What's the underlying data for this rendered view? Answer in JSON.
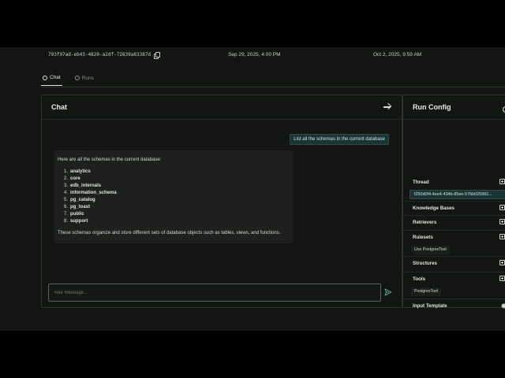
{
  "meta": {
    "run_id": "793f97ad-eb43-4820-a2df-72839a83387d",
    "created": "Sep 29, 2025, 4:00 PM",
    "updated": "Oct 2, 2025, 9:59 AM"
  },
  "tabs": [
    {
      "label": "Chat",
      "icon": "chat-bubble-icon",
      "active": true
    },
    {
      "label": "Runs",
      "icon": "clock-icon",
      "active": false
    }
  ],
  "chat": {
    "title": "Chat",
    "user_message": "List all the schemas in the current database",
    "bot_intro": "Here are all the schemas in the current database:",
    "schemas": [
      {
        "num": "1.",
        "name": "analytics"
      },
      {
        "num": "2.",
        "name": "core"
      },
      {
        "num": "3.",
        "name": "edb_internals"
      },
      {
        "num": "4.",
        "name": "information_schema"
      },
      {
        "num": "5.",
        "name": "pg_catalog"
      },
      {
        "num": "6.",
        "name": "pg_toast"
      },
      {
        "num": "7.",
        "name": "public"
      },
      {
        "num": "8.",
        "name": "support"
      }
    ],
    "bot_outro": "These schemas organize and store different sets of database objects such as tables, views, and functions.",
    "input_placeholder": "Your Message..."
  },
  "run_config": {
    "title": "Run Config",
    "thread_label": "Thread",
    "thread_value": "f250d0f4-4ee4-434b-85ee-576b025992...",
    "knowledge_bases_label": "Knowledge Bases",
    "retrievers_label": "Retrievers",
    "rulesets_label": "Rulesets",
    "ruleset_chip": "Use PostgresTool",
    "structures_label": "Structures",
    "tools_label": "Tools",
    "tool_chip": "PostgresTool",
    "input_template_label": "Input Template"
  },
  "colors": {
    "background": "#121512",
    "accent_chip": "#1c3433",
    "border": "#2f342f"
  }
}
